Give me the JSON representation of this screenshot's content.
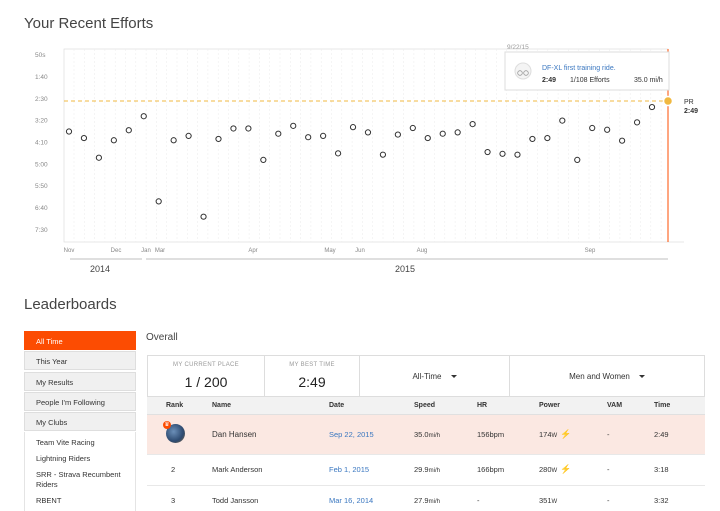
{
  "efforts": {
    "heading": "Your Recent Efforts",
    "y_ticks": [
      "50s",
      "1:40",
      "2:30",
      "3:20",
      "4:10",
      "5:00",
      "5:50",
      "6:40",
      "7:30"
    ],
    "x_months": [
      "Nov",
      "Dec",
      "Jan",
      "Mar",
      "Apr",
      "May",
      "Jun",
      "Aug",
      "Sep"
    ],
    "years": [
      "2014",
      "2015"
    ],
    "pr_label": "PR",
    "pr_value": "2:49",
    "tooltip": {
      "date": "9/22/15",
      "activity": "DF-XL first training ride.",
      "time": "2:49",
      "rank": "1/108 Efforts",
      "speed": "35.0 mi/h"
    },
    "accent": "#fc4c02",
    "pr_color": "#f0b840"
  },
  "chart_data": {
    "type": "scatter",
    "title": "Your Recent Efforts",
    "y_unit": "seconds",
    "y_tick_labels": [
      "50s",
      "1:40",
      "2:30",
      "3:20",
      "4:10",
      "5:00",
      "5:50",
      "6:40",
      "7:30"
    ],
    "ylim": [
      50,
      480
    ],
    "y_inverted": true,
    "x_tick_labels": [
      "Nov",
      "Dec",
      "Jan",
      "Mar",
      "Apr",
      "May",
      "Jun",
      "Aug",
      "Sep"
    ],
    "y_values_seconds": [
      225,
      240,
      285,
      245,
      222,
      190,
      385,
      245,
      235,
      420,
      242,
      218,
      218,
      290,
      230,
      212,
      238,
      235,
      275,
      215,
      227,
      278,
      232,
      217,
      240,
      230,
      227,
      208,
      272,
      276,
      278,
      242,
      240,
      200,
      290,
      217,
      221,
      246,
      204,
      169
    ],
    "pr_line_seconds": 169,
    "pr_label": "PR 2:49",
    "grid": true
  },
  "leaderboards": {
    "heading": "Leaderboards",
    "side_items": [
      "All Time",
      "This Year",
      "My Results",
      "People I'm Following",
      "My Clubs"
    ],
    "clubs": [
      "Team Vite Racing",
      "Lightning Riders",
      "SRR - Strava Recumbent Riders",
      "RBENT"
    ],
    "overall": "Overall",
    "current_place_label": "MY CURRENT PLACE",
    "current_place": "1 / 200",
    "best_time_label": "MY BEST TIME",
    "best_time": "2:49",
    "range_select": "All-Time",
    "gender_select": "Men and Women",
    "columns": [
      "Rank",
      "Name",
      "Date",
      "Speed",
      "HR",
      "Power",
      "VAM",
      "Time"
    ],
    "rows": [
      {
        "rank": "",
        "name": "Dan Hansen",
        "date": "Sep 22, 2015",
        "speed": "35.0",
        "speed_unit": "mi/h",
        "hr": "156bpm",
        "power": "174",
        "power_unit": "W",
        "vam": "-",
        "time": "2:49"
      },
      {
        "rank": "2",
        "name": "Mark Anderson",
        "date": "Feb 1, 2015",
        "speed": "29.9",
        "speed_unit": "mi/h",
        "hr": "166bpm",
        "power": "280",
        "power_unit": "W",
        "vam": "-",
        "time": "3:18"
      },
      {
        "rank": "3",
        "name": "Todd Jansson",
        "date": "Mar 16, 2014",
        "speed": "27.9",
        "speed_unit": "mi/h",
        "hr": "-",
        "power": "351",
        "power_unit": "W",
        "vam": "-",
        "time": "3:32"
      }
    ]
  }
}
